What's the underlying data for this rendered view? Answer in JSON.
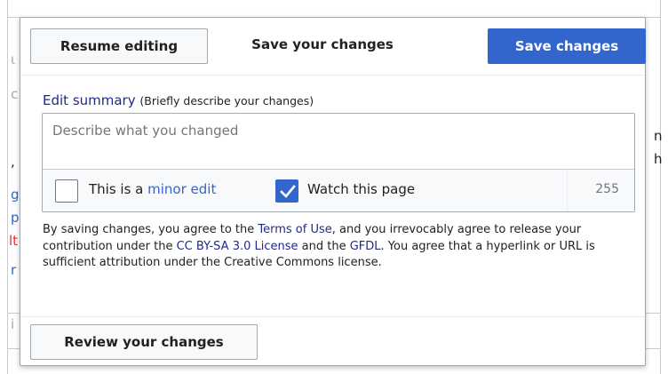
{
  "header": {
    "resume_label": "Resume editing",
    "title": "Save your changes",
    "save_label": "Save changes"
  },
  "summary": {
    "label": "Edit summary",
    "hint": "(Briefly describe your changes)",
    "placeholder": "Describe what you changed",
    "value": ""
  },
  "options": {
    "minor_prefix": "This is a ",
    "minor_link": "minor edit",
    "minor_checked": false,
    "watch_label": "Watch this page",
    "watch_checked": true,
    "char_remaining": "255"
  },
  "legal": {
    "p1": "By saving changes, you agree to the ",
    "terms": "Terms of Use",
    "p2": ", and you irrevocably agree to release your contribution under the ",
    "license": "CC BY-SA 3.0 License",
    "p3": " and the ",
    "gfdl": "GFDL",
    "p4": ". You agree that a hyperlink or URL is sufficient attribution under the Creative Commons license."
  },
  "footer": {
    "review_label": "Review your changes"
  },
  "background_fragments": {
    "left": [
      "ι",
      "c",
      ",",
      "g",
      "p",
      "lt",
      "r",
      "i"
    ],
    "right": [
      "n",
      "h"
    ]
  },
  "colors": {
    "primary": "#3366cc",
    "link_dark": "#202a8a",
    "border": "#a2a9b1",
    "placeholder": "#72777d"
  }
}
